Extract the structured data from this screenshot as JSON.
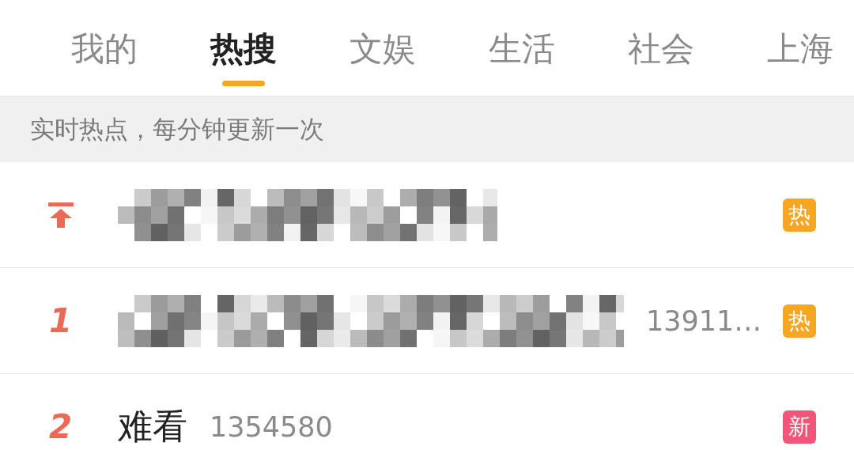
{
  "tabs": [
    {
      "label": "我的",
      "selected": false
    },
    {
      "label": "热搜",
      "selected": true
    },
    {
      "label": "文娱",
      "selected": false
    },
    {
      "label": "生活",
      "selected": false
    },
    {
      "label": "社会",
      "selected": false
    },
    {
      "label": "上海",
      "selected": false
    }
  ],
  "notice": "实时热点，每分钟更新一次",
  "rows": [
    {
      "kind": "pinned",
      "redacted": true,
      "badge": {
        "label": "热",
        "color": "#f5a623"
      }
    },
    {
      "kind": "ranked",
      "rank": "1",
      "redacted": true,
      "count": "13911…",
      "badge": {
        "label": "热",
        "color": "#f5a623"
      }
    },
    {
      "kind": "ranked",
      "rank": "2",
      "title": "难看",
      "count": "1354580",
      "badge": {
        "label": "新",
        "color": "#f2557a"
      }
    }
  ]
}
